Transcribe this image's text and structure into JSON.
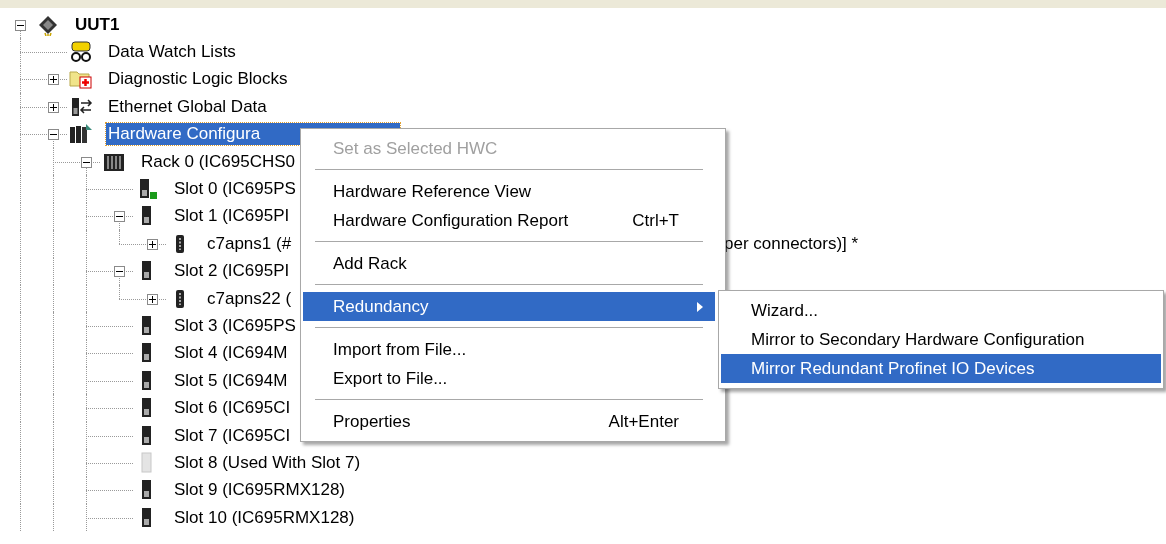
{
  "tree": {
    "label": "UUT1",
    "kind": "chip",
    "bold": true,
    "expanded": true,
    "selected": false,
    "children": [
      {
        "label": "Data Watch Lists",
        "kind": "watch",
        "selected": false
      },
      {
        "label": "Diagnostic Logic Blocks",
        "kind": "folder",
        "expanded": false,
        "selected": false
      },
      {
        "label": "Ethernet Global Data",
        "kind": "network",
        "expanded": false,
        "selected": false
      },
      {
        "label": "Hardware Configura",
        "kind": "config",
        "expanded": true,
        "selected": true,
        "children": [
          {
            "label": "Rack 0 (IC695CHS0",
            "kind": "rack",
            "expanded": true,
            "selected": false,
            "children": [
              {
                "label": "Slot 0 (IC695PS",
                "kind": "power",
                "selected": false
              },
              {
                "label": "Slot 1 (IC695PI",
                "kind": "module",
                "expanded": true,
                "selected": false,
                "children": [
                  {
                    "label": "c7apns1 (#",
                    "tail": "per connectors)] *",
                    "kind": "device",
                    "expanded": false,
                    "selected": false
                  }
                ]
              },
              {
                "label": "Slot 2 (IC695PI",
                "kind": "module",
                "expanded": true,
                "selected": false,
                "children": [
                  {
                    "label": "c7apns22 (",
                    "kind": "device",
                    "expanded": false,
                    "selected": false
                  }
                ]
              },
              {
                "label": "Slot 3 (IC695PS",
                "kind": "module",
                "selected": false
              },
              {
                "label": "Slot 4 (IC694M",
                "kind": "module",
                "selected": false
              },
              {
                "label": "Slot 5 (IC694M",
                "kind": "module",
                "selected": false
              },
              {
                "label": "Slot 6 (IC695CI",
                "kind": "module",
                "selected": false
              },
              {
                "label": "Slot 7 (IC695CI",
                "kind": "module",
                "selected": false
              },
              {
                "label": "Slot 8 (Used With Slot 7)",
                "kind": "empty",
                "selected": false
              },
              {
                "label": "Slot 9 (IC695RMX128)",
                "kind": "module",
                "selected": false
              },
              {
                "label": "Slot 10 (IC695RMX128)",
                "kind": "module",
                "selected": false
              }
            ]
          }
        ]
      }
    ]
  },
  "context_menu": {
    "items": [
      {
        "kind": "item",
        "label": "Set as Selected HWC",
        "disabled": true,
        "selected": false
      },
      {
        "kind": "separator"
      },
      {
        "kind": "item",
        "label": "Hardware Reference View",
        "disabled": false,
        "selected": false
      },
      {
        "kind": "item",
        "label": "Hardware Configuration Report",
        "shortcut": "Ctrl+T",
        "disabled": false,
        "selected": false
      },
      {
        "kind": "separator"
      },
      {
        "kind": "item",
        "label": "Add Rack",
        "disabled": false,
        "selected": false
      },
      {
        "kind": "separator"
      },
      {
        "kind": "item",
        "label": "Redundancy",
        "submenu": true,
        "disabled": false,
        "selected": true
      },
      {
        "kind": "separator"
      },
      {
        "kind": "item",
        "label": "Import from File...",
        "disabled": false,
        "selected": false
      },
      {
        "kind": "item",
        "label": "Export to File...",
        "disabled": false,
        "selected": false
      },
      {
        "kind": "separator"
      },
      {
        "kind": "item",
        "label": "Properties",
        "shortcut": "Alt+Enter",
        "disabled": false,
        "selected": false
      }
    ]
  },
  "submenu": {
    "items": [
      {
        "kind": "item",
        "label": "Wizard...",
        "disabled": false,
        "selected": false
      },
      {
        "kind": "item",
        "label": "Mirror to Secondary Hardware Configuration",
        "disabled": false,
        "selected": false
      },
      {
        "kind": "item",
        "label": "Mirror Redundant Profinet IO Devices",
        "disabled": false,
        "selected": true
      }
    ]
  }
}
